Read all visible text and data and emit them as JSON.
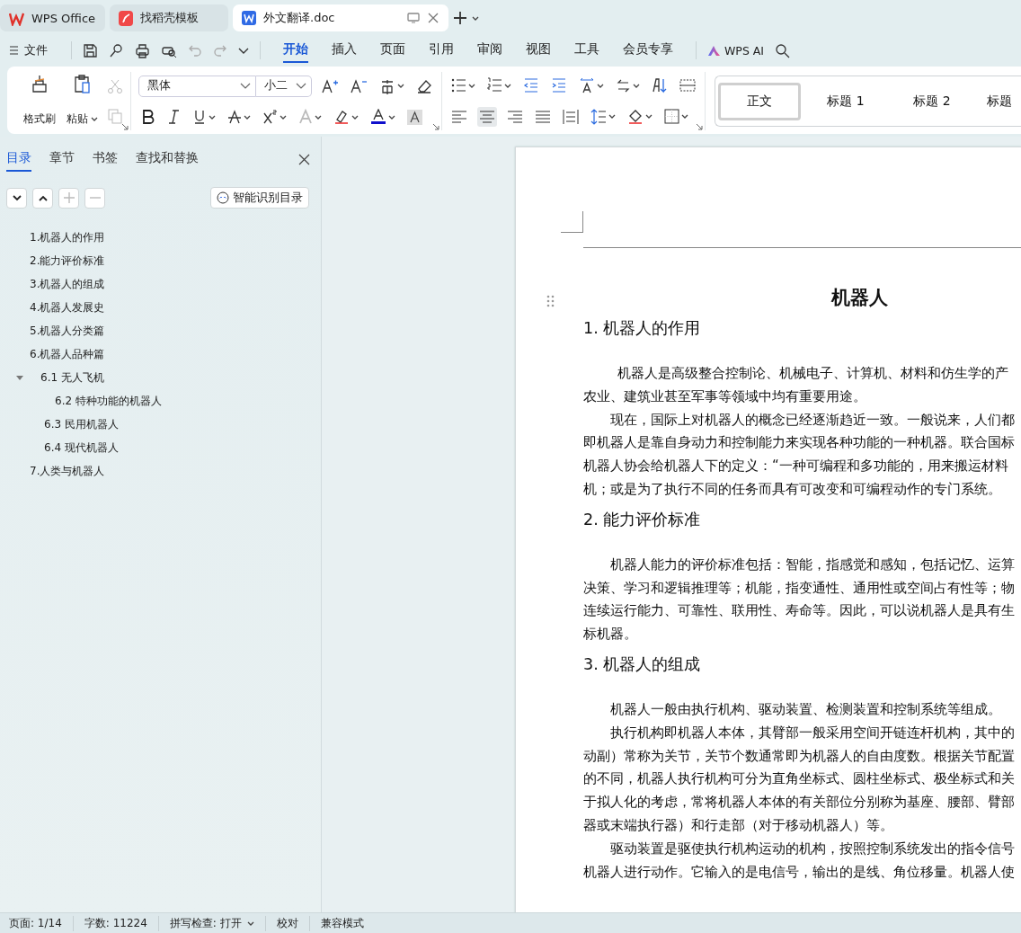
{
  "window_tabs": [
    {
      "label": "WPS Office",
      "kind": "home",
      "selected": false
    },
    {
      "label": "找稻壳模板",
      "kind": "template",
      "selected": false
    },
    {
      "label": "外文翻译.doc",
      "kind": "doc",
      "selected": true
    }
  ],
  "menu": {
    "file": "文件",
    "tabs": [
      {
        "label": "开始",
        "selected": true
      },
      {
        "label": "插入",
        "selected": false
      },
      {
        "label": "页面",
        "selected": false
      },
      {
        "label": "引用",
        "selected": false
      },
      {
        "label": "审阅",
        "selected": false
      },
      {
        "label": "视图",
        "selected": false
      },
      {
        "label": "工具",
        "selected": false
      },
      {
        "label": "会员专享",
        "selected": false
      }
    ],
    "ai": "WPS AI"
  },
  "ribbon": {
    "format_painter": "格式刷",
    "paste": "粘贴",
    "font": "黑体",
    "size": "小二",
    "alignments": [
      {
        "kind": "left",
        "selected": false
      },
      {
        "kind": "center",
        "selected": true
      },
      {
        "kind": "right",
        "selected": false
      },
      {
        "kind": "justify",
        "selected": false
      },
      {
        "kind": "distribute",
        "selected": false
      }
    ],
    "styles": [
      {
        "label": "正文",
        "selected": true
      },
      {
        "label": "标题 1",
        "selected": false
      },
      {
        "label": "标题 2",
        "selected": false
      },
      {
        "label": "标题",
        "selected": false
      }
    ]
  },
  "nav": {
    "tabs": [
      {
        "label": "目录",
        "selected": true
      },
      {
        "label": "章节",
        "selected": false
      },
      {
        "label": "书签",
        "selected": false
      },
      {
        "label": "查找和替换",
        "selected": false
      }
    ],
    "smart_button": "智能识别目录",
    "outline": [
      {
        "label": "1.机器人的作用"
      },
      {
        "label": "2.能力评价标准"
      },
      {
        "label": "3.机器人的组成"
      },
      {
        "label": "4.机器人发展史"
      },
      {
        "label": "5.机器人分类篇"
      },
      {
        "label": "6.机器人品种篇",
        "children": [
          {
            "label": "6.1 无人飞机",
            "expanded": true,
            "children": [
              {
                "label": "6.2 特种功能的机器人"
              }
            ]
          },
          {
            "label": "6.3 民用机器人"
          },
          {
            "label": "6.4 现代机器人"
          }
        ]
      },
      {
        "label": "7.人类与机器人"
      }
    ]
  },
  "document": {
    "title": "机器人",
    "sections": [
      {
        "heading": "1. 机器人的作用",
        "paragraphs": [
          [
            "机器人是高级整合控制论、机械电子、计算机、材料和仿生学的产",
            "农业、建筑业甚至军事等领域中均有重要用途。"
          ],
          [
            "现在，国际上对机器人的概念已经逐渐趋近一致。一般说来，人们都",
            "即机器人是靠自身动力和控制能力来实现各种功能的一种机器。联合国标",
            "机器人协会给机器人下的定义：“一种可编程和多功能的，用来搬运材料",
            "机；或是为了执行不同的任务而具有可改变和可编程动作的专门系统。"
          ]
        ]
      },
      {
        "heading": "2. 能力评价标准",
        "paragraphs": [
          [
            "机器人能力的评价标准包括：智能，指感觉和感知，包括记忆、运算",
            "决策、学习和逻辑推理等；机能，指变通性、通用性或空间占有性等；物",
            "连续运行能力、可靠性、联用性、寿命等。因此，可以说机器人是具有生",
            "标机器。"
          ]
        ]
      },
      {
        "heading": "3. 机器人的组成",
        "paragraphs": [
          [
            "机器人一般由执行机构、驱动装置、检测装置和控制系统等组成。"
          ],
          [
            "执行机构即机器人本体，其臂部一般采用空间开链连杆机构，其中的",
            "动副）常称为关节，关节个数通常即为机器人的自由度数。根据关节配置",
            "的不同，机器人执行机构可分为直角坐标式、圆柱坐标式、极坐标式和关",
            "于拟人化的考虑，常将机器人本体的有关部位分别称为基座、腰部、臂部",
            "器或末端执行器）和行走部（对于移动机器人）等。"
          ],
          [
            "驱动装置是驱使执行机构运动的机构，按照控制系统发出的指令信号",
            "机器人进行动作。它输入的是电信号，输出的是线、角位移量。机器人使"
          ]
        ]
      }
    ]
  },
  "status_bar": {
    "page": "页面: 1/14",
    "words": "字数: 11224",
    "spell": "拼写检查: 打开",
    "proof": "校对",
    "compat": "兼容模式"
  }
}
